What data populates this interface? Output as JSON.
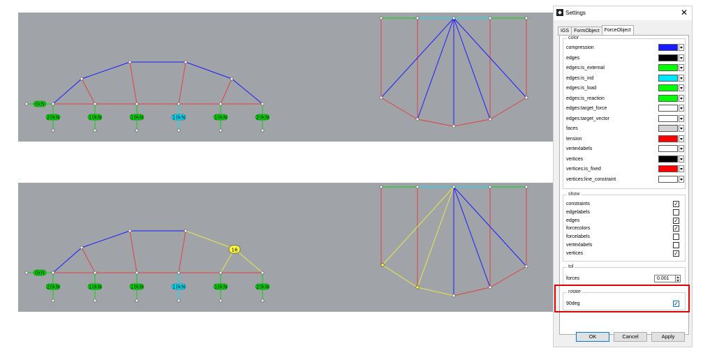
{
  "diagram_top": {
    "loads": [
      "20kN",
      "10kN",
      "10kN",
      "10kN",
      "10kN",
      "20kN"
    ],
    "support_label": "0kN"
  },
  "diagram_bottom": {
    "loads": [
      "20kN",
      "10kN",
      "10kN",
      "10kN",
      "10kN",
      "20kN"
    ],
    "support_label": "0kN",
    "vertex_label": "16"
  },
  "load_colors": [
    "#00dd00",
    "#00dd00",
    "#00dd00",
    "#00e5ff",
    "#00dd00",
    "#00dd00"
  ],
  "colors": {
    "compression": "#1a1aff",
    "tension": "#e04040",
    "external": "#00dd00",
    "ind": "#00e5ff",
    "selected": "#ffff40"
  },
  "dialog": {
    "title": "Settings",
    "close_icon": "close-icon",
    "tabs": [
      {
        "label": "IGS"
      },
      {
        "label": "FormObject"
      },
      {
        "label": "ForceObject"
      }
    ],
    "color_group": {
      "legend": "color",
      "rows": [
        {
          "label": "compression",
          "color": "#1a1aff"
        },
        {
          "label": "edges",
          "color": "#000000"
        },
        {
          "label": "edges:is_external",
          "color": "#00ff00"
        },
        {
          "label": "edges:is_ind",
          "color": "#00e5ff"
        },
        {
          "label": "edges:is_load",
          "color": "#00ff00"
        },
        {
          "label": "edges:is_reaction",
          "color": "#00ff00"
        },
        {
          "label": "edges:target_force",
          "color": "#ffffff"
        },
        {
          "label": "edges:target_vector",
          "color": "#ffffff"
        },
        {
          "label": "faces",
          "color": "#d3d3d3"
        },
        {
          "label": "tension",
          "color": "#ff0000"
        },
        {
          "label": "vertexlabels",
          "color": "#ffffff"
        },
        {
          "label": "vertices",
          "color": "#000000"
        },
        {
          "label": "vertices:is_fixed",
          "color": "#ff0000"
        },
        {
          "label": "vertices:line_constraint",
          "color": "#ffffff"
        }
      ]
    },
    "show_group": {
      "legend": "show",
      "rows": [
        {
          "label": "constraints",
          "checked": "✓"
        },
        {
          "label": "edgelabels",
          "checked": ""
        },
        {
          "label": "edges",
          "checked": "✓"
        },
        {
          "label": "forcecolors",
          "checked": "✓"
        },
        {
          "label": "forcelabels",
          "checked": ""
        },
        {
          "label": "vertexlabels",
          "checked": ""
        },
        {
          "label": "vertices",
          "checked": "✓"
        }
      ]
    },
    "tol_group": {
      "legend": "tol",
      "label": "forces",
      "value": "0.001"
    },
    "rotate_group": {
      "legend": "rotate",
      "label": "90deg",
      "checked": "✓"
    },
    "buttons": {
      "ok": "OK",
      "cancel": "Cancel",
      "apply": "Apply"
    }
  }
}
